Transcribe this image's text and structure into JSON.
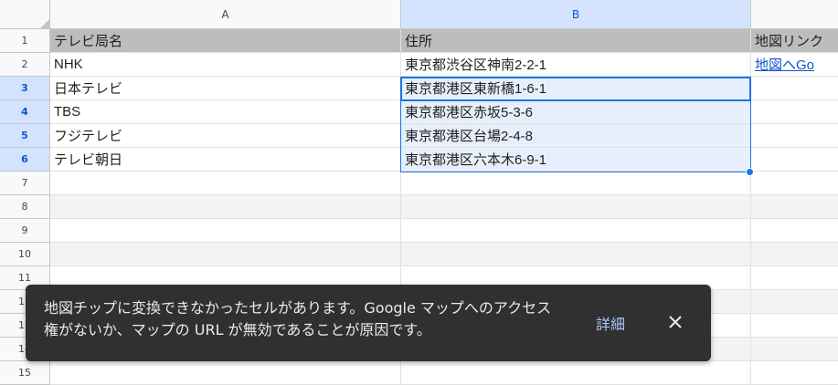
{
  "sheet": {
    "columns": [
      {
        "label": "A"
      },
      {
        "label": "B"
      },
      {
        "label": ""
      }
    ],
    "rows": [
      {
        "num": "1",
        "a": "テレビ局名",
        "b": "住所",
        "c": "地図リンク"
      },
      {
        "num": "2",
        "a": "NHK",
        "b": "東京都渋谷区神南2-2-1",
        "c": "地図へGo"
      },
      {
        "num": "3",
        "a": "日本テレビ",
        "b": "東京都港区東新橋1-6-1",
        "c": ""
      },
      {
        "num": "4",
        "a": "TBS",
        "b": "東京都港区赤坂5-3-6",
        "c": ""
      },
      {
        "num": "5",
        "a": "フジテレビ",
        "b": "東京都港区台場2-4-8",
        "c": ""
      },
      {
        "num": "6",
        "a": "テレビ朝日",
        "b": "東京都港区六本木6-9-1",
        "c": ""
      },
      {
        "num": "7",
        "a": "",
        "b": "",
        "c": ""
      },
      {
        "num": "8",
        "a": "",
        "b": "",
        "c": ""
      },
      {
        "num": "9",
        "a": "",
        "b": "",
        "c": ""
      },
      {
        "num": "10",
        "a": "",
        "b": "",
        "c": ""
      },
      {
        "num": "11",
        "a": "",
        "b": "",
        "c": ""
      },
      {
        "num": "12",
        "a": "",
        "b": "",
        "c": ""
      },
      {
        "num": "13",
        "a": "",
        "b": "",
        "c": ""
      },
      {
        "num": "14",
        "a": "",
        "b": "",
        "c": ""
      },
      {
        "num": "15",
        "a": "",
        "b": "",
        "c": ""
      }
    ]
  },
  "toast": {
    "message": "地図チップに変換できなかったセルがあります。Google マップへのアクセス権がないか、マップの URL が無効であることが原因です。",
    "action": "詳細",
    "close_icon": "close-icon"
  },
  "colors": {
    "header_row_bg": "#bdbdbd",
    "banding_bg": "#f3f3f3",
    "selection_border": "#1a73e8",
    "link": "#1155cc",
    "toast_bg": "#303030"
  }
}
